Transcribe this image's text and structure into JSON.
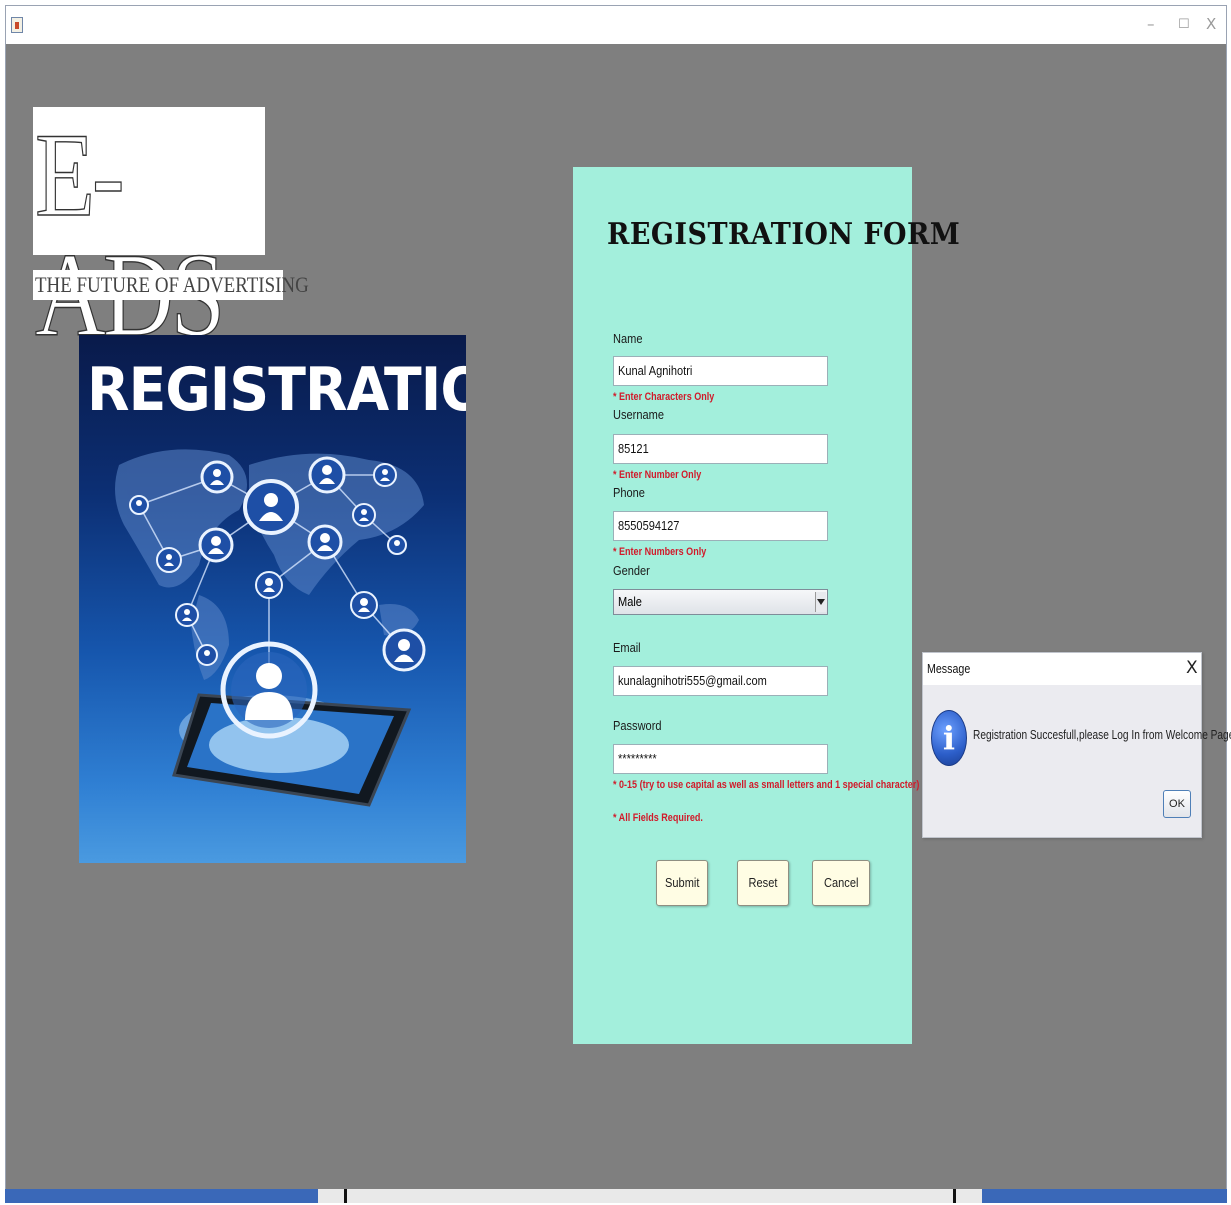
{
  "window": {
    "minimize": "–",
    "maximize": "☐",
    "close": "X"
  },
  "logo": {
    "text": "E-ADS",
    "tagline": "THE FUTURE OF ADVERTISING"
  },
  "hero": {
    "title": "REGISTRATION"
  },
  "form": {
    "title": "REGISTRATION FORM",
    "name_label": "Name",
    "name_value": "Kunal Agnihotri",
    "name_hint": "* Enter Characters Only",
    "username_label": "Username",
    "username_value": "85121",
    "username_hint": "* Enter Number Only",
    "phone_label": "Phone",
    "phone_value": "8550594127",
    "phone_hint": "* Enter Numbers Only",
    "gender_label": "Gender",
    "gender_value": "Male",
    "email_label": "Email",
    "email_value": "kunalagnihotri555@gmail.com",
    "password_label": "Password",
    "password_value": "*********",
    "password_hint": "*  0-15 (try to use capital as well as small letters and 1 special character)",
    "required_hint": "* All Fields Required.",
    "submit_label": "Submit",
    "reset_label": "Reset",
    "cancel_label": "Cancel"
  },
  "dialog": {
    "title": "Message",
    "close": "X",
    "icon_glyph": "i",
    "message": "Registration Succesfull,please Log In from Welcome Page",
    "ok_label": "OK"
  },
  "colors": {
    "background": "#7f7f7f",
    "form_panel": "#a3efdc",
    "hint": "#d11a2a",
    "button": "#fffde4"
  }
}
